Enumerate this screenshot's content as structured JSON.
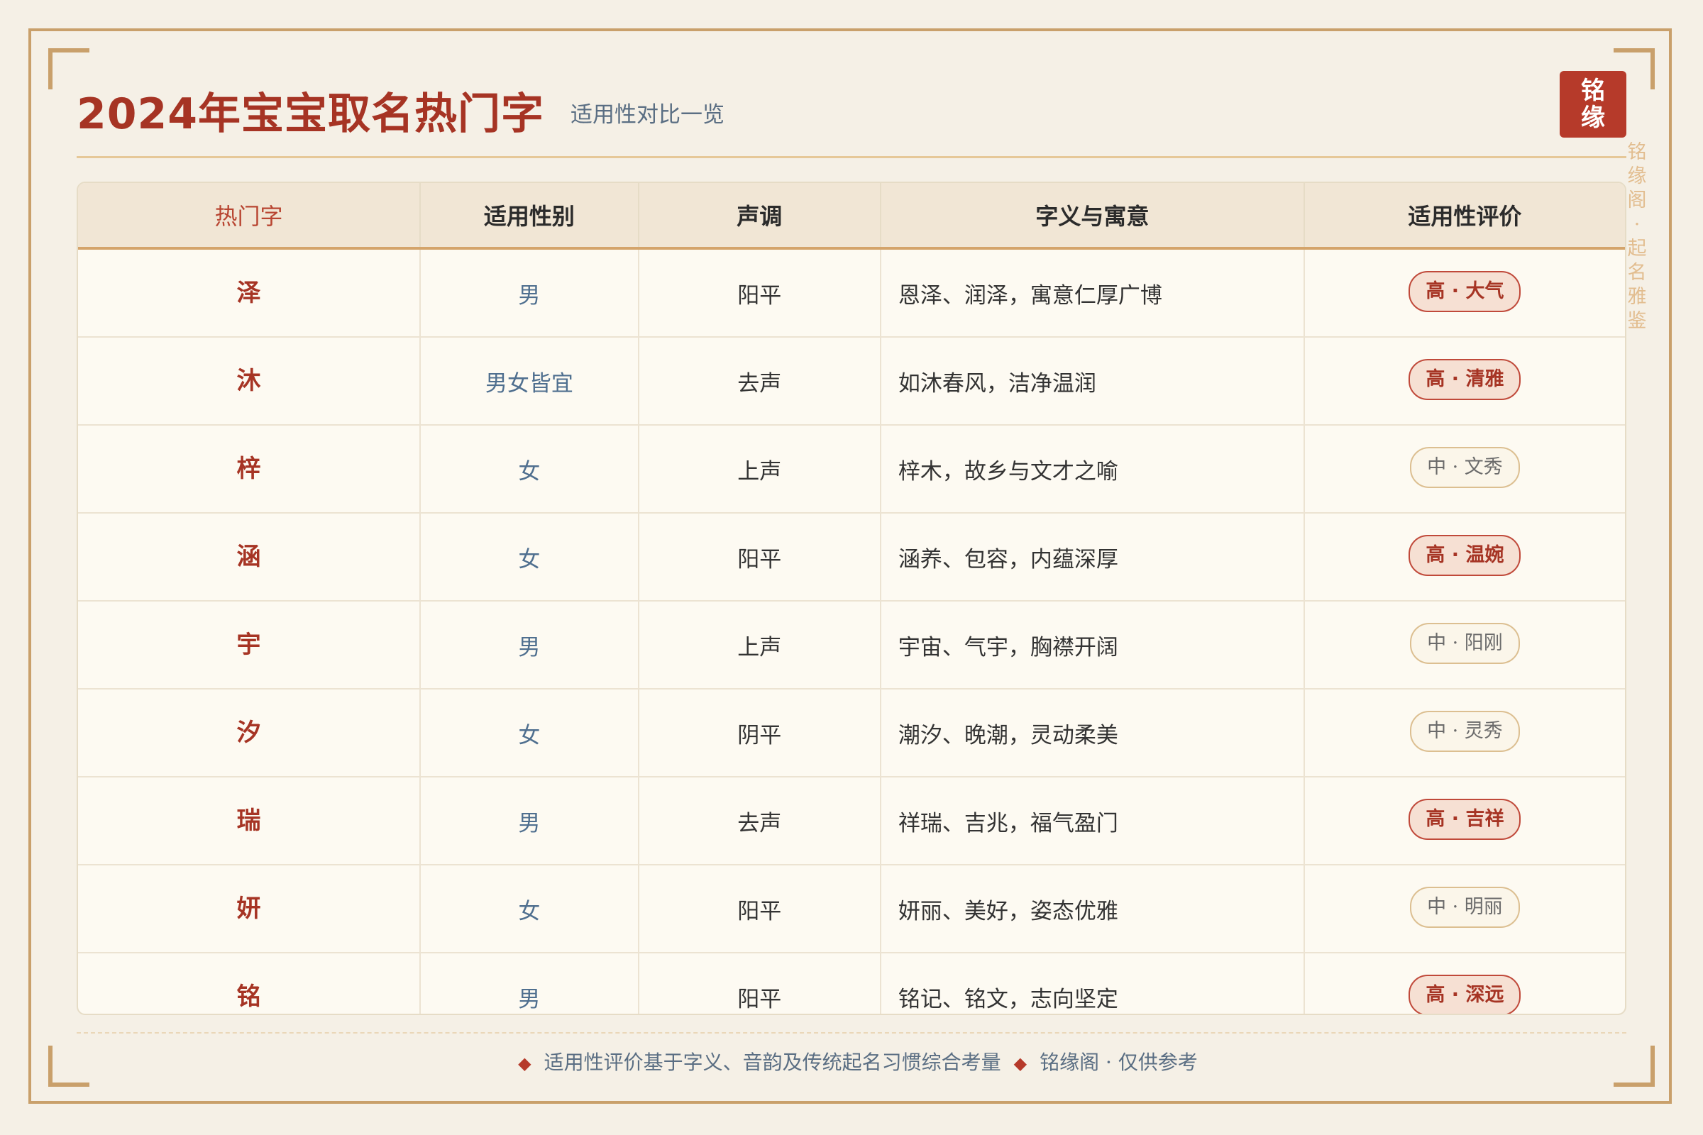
{
  "header": {
    "title": "2024年宝宝取名热门字",
    "subtitle": "适用性对比一览",
    "seal": [
      "铭",
      "缘"
    ],
    "side_text": [
      "铭",
      "缘",
      "阁",
      "·",
      "起",
      "名",
      "雅",
      "鉴"
    ]
  },
  "table": {
    "headers": [
      "热门字",
      "适用性别",
      "声调",
      "字义与寓意",
      "适用性评价"
    ],
    "rows": [
      {
        "char": "泽",
        "gender": "男",
        "tone": "阳平",
        "meaning": "恩泽、润泽，寓意仁厚广博",
        "rating": "高 · 大气",
        "level": "high"
      },
      {
        "char": "沐",
        "gender": "男女皆宜",
        "tone": "去声",
        "meaning": "如沐春风，洁净温润",
        "rating": "高 · 清雅",
        "level": "high"
      },
      {
        "char": "梓",
        "gender": "女",
        "tone": "上声",
        "meaning": "梓木，故乡与文才之喻",
        "rating": "中 · 文秀",
        "level": "mid"
      },
      {
        "char": "涵",
        "gender": "女",
        "tone": "阳平",
        "meaning": "涵养、包容，内蕴深厚",
        "rating": "高 · 温婉",
        "level": "high"
      },
      {
        "char": "宇",
        "gender": "男",
        "tone": "上声",
        "meaning": "宇宙、气宇，胸襟开阔",
        "rating": "中 · 阳刚",
        "level": "mid"
      },
      {
        "char": "汐",
        "gender": "女",
        "tone": "阴平",
        "meaning": "潮汐、晚潮，灵动柔美",
        "rating": "中 · 灵秀",
        "level": "mid"
      },
      {
        "char": "瑞",
        "gender": "男",
        "tone": "去声",
        "meaning": "祥瑞、吉兆，福气盈门",
        "rating": "高 · 吉祥",
        "level": "high"
      },
      {
        "char": "妍",
        "gender": "女",
        "tone": "阳平",
        "meaning": "妍丽、美好，姿态优雅",
        "rating": "中 · 明丽",
        "level": "mid"
      },
      {
        "char": "铭",
        "gender": "男",
        "tone": "阳平",
        "meaning": "铭记、铭文，志向坚定",
        "rating": "高 · 深远",
        "level": "high"
      }
    ]
  },
  "footer": {
    "note": "适用性评价基于字义、音韵及传统起名习惯综合考量",
    "brand": "铭缘阁 · 仅供参考"
  }
}
